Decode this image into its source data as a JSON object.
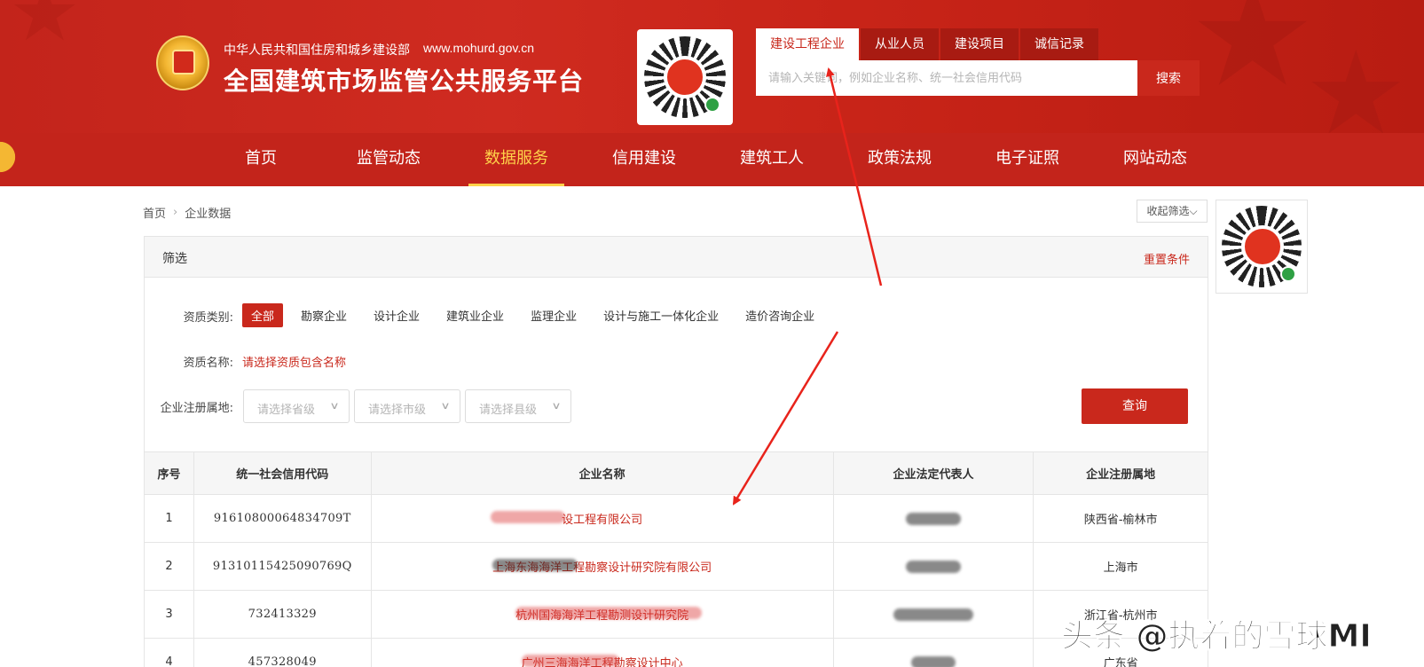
{
  "header": {
    "org_name": "中华人民共和国住房和城乡建设部",
    "site_url": "www.mohurd.gov.cn",
    "platform_title": "全国建筑市场监管公共服务平台",
    "brand_color": "#c3241b"
  },
  "search": {
    "tabs": [
      {
        "label": "建设工程企业",
        "active": true
      },
      {
        "label": "从业人员",
        "active": false
      },
      {
        "label": "建设项目",
        "active": false
      },
      {
        "label": "诚信记录",
        "active": false
      }
    ],
    "placeholder": "请输入关键词，例如企业名称、统一社会信用代码",
    "button_label": "搜索"
  },
  "main_nav": [
    {
      "label": "首页"
    },
    {
      "label": "监管动态"
    },
    {
      "label": "数据服务",
      "active": true
    },
    {
      "label": "信用建设"
    },
    {
      "label": "建筑工人"
    },
    {
      "label": "政策法规"
    },
    {
      "label": "电子证照"
    },
    {
      "label": "网站动态"
    }
  ],
  "breadcrumb": [
    "首页",
    "企业数据"
  ],
  "collapse_label": "收起筛选",
  "filter": {
    "title": "筛选",
    "reset_label": "重置条件",
    "category_label": "资质类别:",
    "categories": [
      "全部",
      "勘察企业",
      "设计企业",
      "建筑业企业",
      "监理企业",
      "设计与施工一体化企业",
      "造价咨询企业"
    ],
    "qualification_label": "资质名称:",
    "qualification_link": "请选择资质包含名称",
    "location_label": "企业注册属地:",
    "province_placeholder": "请选择省级",
    "city_placeholder": "请选择市级",
    "county_placeholder": "请选择县级",
    "query_label": "查询"
  },
  "table": {
    "headers": [
      "序号",
      "统一社会信用代码",
      "企业名称",
      "企业法定代表人",
      "企业注册属地"
    ],
    "rows": [
      {
        "no": "1",
        "code": "91610800064834709T",
        "name": "设工程有限公司",
        "rep": "",
        "location": "陕西省-榆林市"
      },
      {
        "no": "2",
        "code": "91310115425090769Q",
        "name": "上海东海海洋工程勘察设计研究院有限公司",
        "rep": "",
        "location": "上海市"
      },
      {
        "no": "3",
        "code": "732413329",
        "name": "杭州国海海洋工程勘测设计研究院",
        "rep": "",
        "location": "浙江省-杭州市"
      },
      {
        "no": "4",
        "code": "457328049",
        "name": "广州三海海洋工程勘察设计中心",
        "rep": "",
        "location": "广东省"
      }
    ]
  },
  "watermark": "头条 @执着的雪球MI",
  "annotation_color": "#e8231b",
  "icons": [
    "emblem-icon",
    "qr-code-icon",
    "chevron-down-icon",
    "chevron-right-icon"
  ]
}
